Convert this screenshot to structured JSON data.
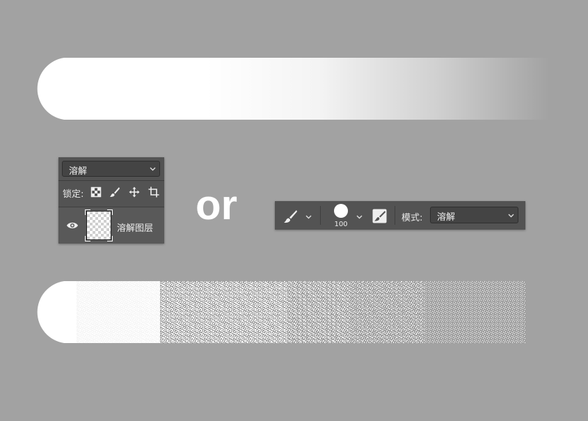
{
  "layers_panel": {
    "blend_mode": "溶解",
    "lock_label": "锁定:",
    "layer_name": "溶解图层",
    "icons": [
      "lock-transparent-pixels-icon",
      "lock-image-pixels-icon",
      "lock-position-icon",
      "lock-artboard-icon",
      "eye-icon"
    ]
  },
  "separator_text": "or",
  "options_bar": {
    "brush_size": "100",
    "mode_label": "模式:",
    "mode_value": "溶解",
    "icons": [
      "brush-tool-icon",
      "brush-tip-icon",
      "brush-panel-toggle-icon"
    ]
  },
  "colors": {
    "canvas": "#a2a2a2",
    "panel": "#535353",
    "stroke": "#ffffff"
  }
}
